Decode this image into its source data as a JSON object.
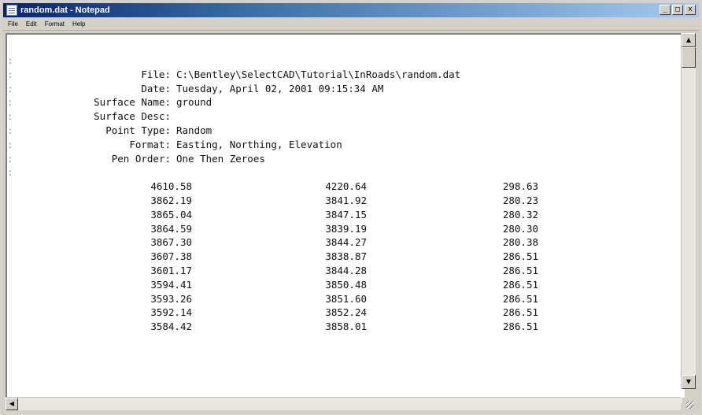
{
  "window": {
    "title": "random.dat - Notepad",
    "controls": {
      "minimize": "_",
      "maximize": "□",
      "close": "x"
    }
  },
  "menu": [
    "File",
    "Edit",
    "Format",
    "Help"
  ],
  "gutter_mark": ":",
  "header": [
    {
      "label": "",
      "value": ""
    },
    {
      "label": "File:",
      "value": "C:\\Bentley\\SelectCAD\\Tutorial\\InRoads\\random.dat"
    },
    {
      "label": "Date:",
      "value": "Tuesday, April 02, 2001 09:15:34 AM"
    },
    {
      "label": "Surface Name:",
      "value": "ground"
    },
    {
      "label": "Surface Desc:",
      "value": ""
    },
    {
      "label": "Point Type:",
      "value": "Random"
    },
    {
      "label": "Format:",
      "value": "Easting, Northing, Elevation"
    },
    {
      "label": "Pen Order:",
      "value": "One Then Zeroes"
    },
    {
      "label": "",
      "value": ""
    }
  ],
  "rows": [
    [
      "4610.58",
      "4220.64",
      "298.63"
    ],
    [
      "3862.19",
      "3841.92",
      "280.23"
    ],
    [
      "3865.04",
      "3847.15",
      "280.32"
    ],
    [
      "3864.59",
      "3839.19",
      "280.30"
    ],
    [
      "3867.30",
      "3844.27",
      "280.38"
    ],
    [
      "3607.38",
      "3838.87",
      "286.51"
    ],
    [
      "3601.17",
      "3844.28",
      "286.51"
    ],
    [
      "3594.41",
      "3850.48",
      "286.51"
    ],
    [
      "3593.26",
      "3851.60",
      "286.51"
    ],
    [
      "3592.14",
      "3852.24",
      "286.51"
    ],
    [
      "3584.42",
      "3858.01",
      "286.51"
    ]
  ],
  "colors": {
    "title_active_start": "#0a246a",
    "title_active_end": "#a6caf0",
    "chrome": "#d4d0c8"
  }
}
